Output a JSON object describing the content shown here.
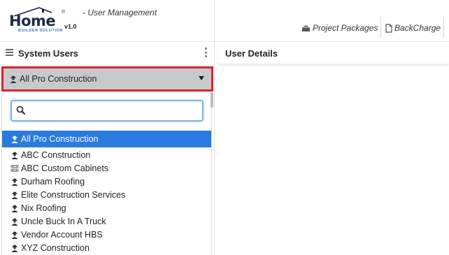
{
  "header": {
    "logo_word": "Home",
    "logo_reg": "®",
    "logo_sub": "BUILDER SOLUTION",
    "logo_version": "v1.0",
    "page_subtitle": "- User Management",
    "links": [
      {
        "label": "Project Packages",
        "icon": "package-icon"
      },
      {
        "label": "BackCharge",
        "icon": "document-icon"
      }
    ]
  },
  "left_panel": {
    "title": "System Users",
    "selected_company": "All Pro Construction",
    "search": {
      "value": "",
      "placeholder": ""
    },
    "options": [
      {
        "label": "All Pro Construction",
        "icon": "user-icon",
        "selected": true
      },
      {
        "label": "ABC Construction",
        "icon": "user-icon",
        "selected": false
      },
      {
        "label": "ABC Custom Cabinets",
        "icon": "cabinet-icon",
        "selected": false
      },
      {
        "label": "Durham Roofing",
        "icon": "user-icon",
        "selected": false
      },
      {
        "label": "Elite Construction Services",
        "icon": "user-icon",
        "selected": false
      },
      {
        "label": "Nix Roofing",
        "icon": "user-icon",
        "selected": false
      },
      {
        "label": "Uncle Buck In A Truck",
        "icon": "user-icon",
        "selected": false
      },
      {
        "label": "Vendor Account HBS",
        "icon": "user-icon",
        "selected": false
      },
      {
        "label": "XYZ Construction",
        "icon": "user-icon",
        "selected": false
      }
    ]
  },
  "right_panel": {
    "title": "User Details"
  },
  "colors": {
    "accent": "#2a7be0",
    "highlight_border": "#d9232a",
    "selector_bg": "#c7cacd",
    "logo_navy": "#1e2b44"
  }
}
